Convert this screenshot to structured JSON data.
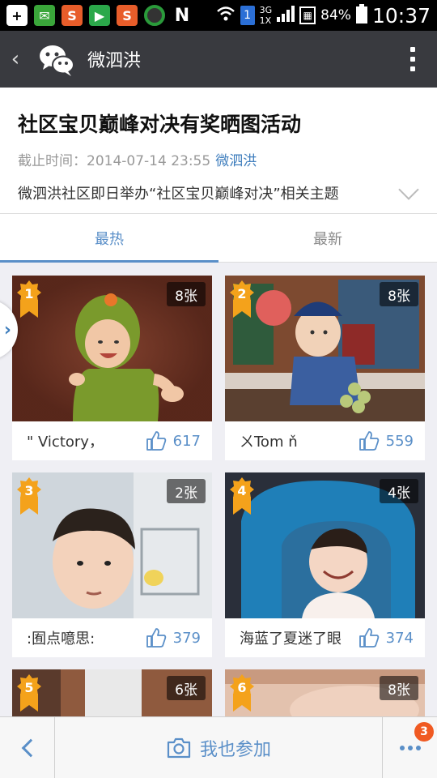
{
  "status_bar": {
    "battery": "84%",
    "time": "10:37",
    "network": "3G",
    "net_sub": "1X",
    "icons": [
      "add-icon",
      "wechat-notify-icon",
      "app-s-icon",
      "play-store-icon",
      "app-s2-icon",
      "app-chrome-like-icon",
      "n-icon",
      "wifi-icon",
      "sim-1-icon",
      "signal-icon",
      "data-icon",
      "battery-icon"
    ]
  },
  "titlebar": {
    "back_icon": "back-chevron-icon",
    "logo_icon": "wechat-logo-icon",
    "title": "微泗洪",
    "menu_icon": "more-vertical-icon"
  },
  "header": {
    "title": "社区宝贝巅峰对决有奖晒图活动",
    "deadline": "截止时间：2014-07-14 23:55",
    "author": "微泗洪",
    "desc": "微泗洪社区即日举办“社区宝贝巅峰对决”相关主题"
  },
  "tabs": [
    {
      "label": "最热",
      "active": true
    },
    {
      "label": "最新",
      "active": false
    }
  ],
  "cards": [
    {
      "rank": "1",
      "count": "8张",
      "name": "\" Victory，",
      "likes": "617"
    },
    {
      "rank": "2",
      "count": "8张",
      "name": "ㄨTom ň",
      "likes": "559"
    },
    {
      "rank": "3",
      "count": "2张",
      "name": ":囿点噫思:",
      "likes": "379"
    },
    {
      "rank": "4",
      "count": "4张",
      "name": "海蓝了夏迷了眼",
      "likes": "374"
    },
    {
      "rank": "5",
      "count": "6张",
      "name": "",
      "likes": ""
    },
    {
      "rank": "6",
      "count": "8张",
      "name": "",
      "likes": ""
    }
  ],
  "bottom_bar": {
    "join_label": "我也参加",
    "camera_icon": "camera-icon",
    "more_badge": "3"
  },
  "colors": {
    "accent": "#5a8fc8",
    "titlebar": "#393a3f",
    "badge_gold": "#f4a21b",
    "notify": "#f05a22"
  }
}
